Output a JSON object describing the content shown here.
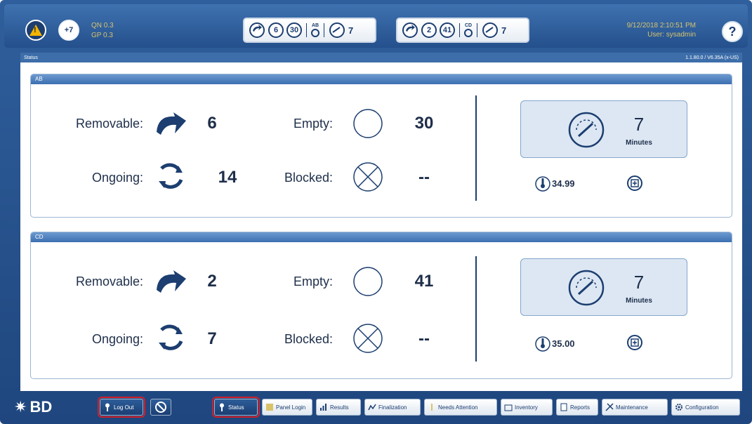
{
  "topbar": {
    "count_badge": "+7",
    "qc_line1": "QN 0.3",
    "qc_line2": "GP 0.3",
    "groups": [
      {
        "removable": "6",
        "empty": "30",
        "label": "AB",
        "minutes": "7"
      },
      {
        "removable": "2",
        "empty": "41",
        "label": "CD",
        "minutes": "7"
      }
    ],
    "date": "9/12/2018 2:10:51 PM",
    "user": "User: sysadmin",
    "help": "?"
  },
  "status_strip": {
    "title": "Status",
    "version": "1.1.80.0 / V6.35A (x-US)"
  },
  "panels": [
    {
      "name": "AB",
      "removable_label": "Removable:",
      "removable": "6",
      "empty_label": "Empty:",
      "empty": "30",
      "ongoing_label": "Ongoing:",
      "ongoing": "14",
      "blocked_label": "Blocked:",
      "blocked": "--",
      "minutes": "7",
      "minutes_unit": "Minutes",
      "temperature": "34.99"
    },
    {
      "name": "CD",
      "removable_label": "Removable:",
      "removable": "2",
      "empty_label": "Empty:",
      "empty": "41",
      "ongoing_label": "Ongoing:",
      "ongoing": "7",
      "blocked_label": "Blocked:",
      "blocked": "--",
      "minutes": "7",
      "minutes_unit": "Minutes",
      "temperature": "35.00"
    }
  ],
  "bottombar": {
    "logo": "BD",
    "logout": "Log Out",
    "tabs": [
      "Status",
      "Panel Login",
      "Results",
      "Finalization",
      "Needs Attention",
      "Inventory",
      "Reports",
      "Maintenance",
      "Configuration"
    ]
  },
  "colors": {
    "accent": "#1c3e70",
    "highlight": "#d0202a",
    "frame": "#24508c"
  }
}
